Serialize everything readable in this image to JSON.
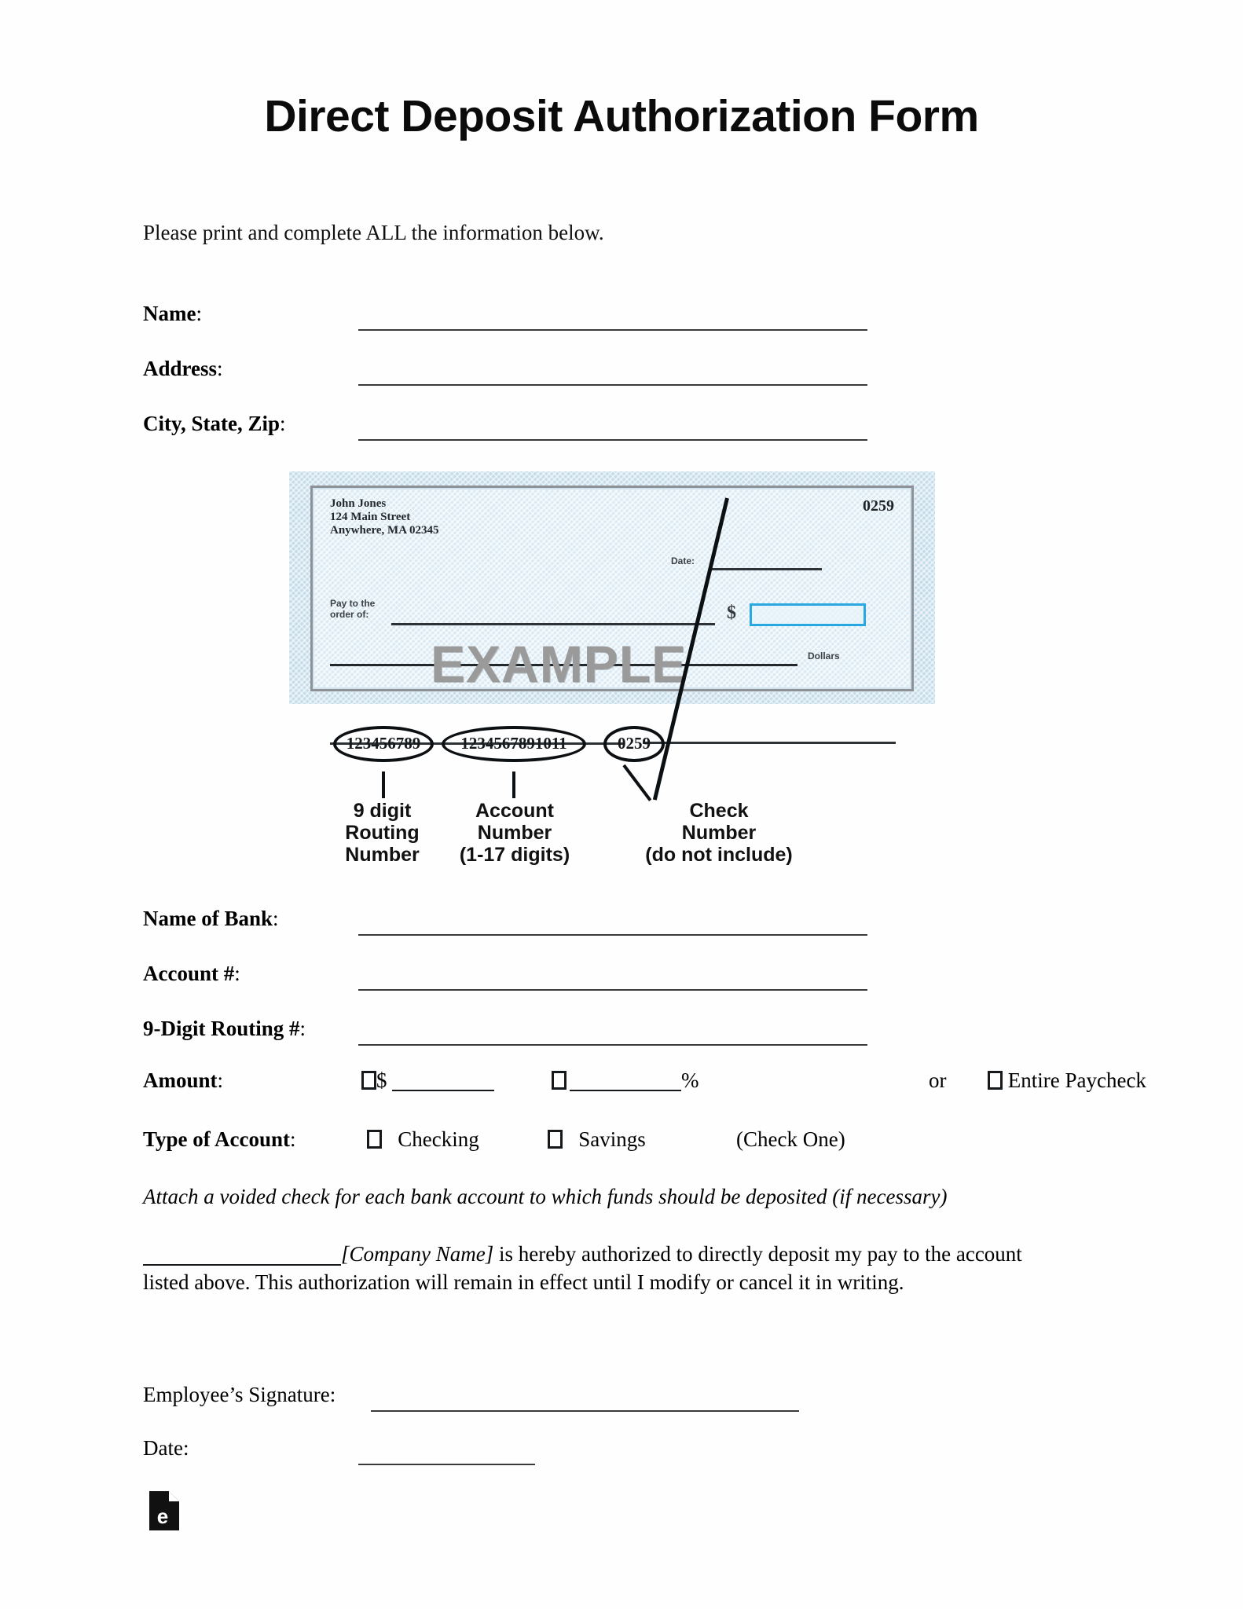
{
  "document": {
    "title": "Direct Deposit Authorization Form",
    "intro": "Please print and complete ALL the information below."
  },
  "personal_fields": [
    {
      "label": "Name",
      "colon": ":"
    },
    {
      "label": "Address",
      "colon": ":"
    },
    {
      "label": "City, State, Zip",
      "colon": ":"
    }
  ],
  "check_illustration": {
    "payer_block": "John Jones\n124 Main Street\nAnywhere, MA 02345",
    "check_number_top": "0259",
    "date_label": "Date:",
    "pay_to_label": "Pay to the\norder of:",
    "dollar_sign": "$",
    "dollars_label": "Dollars",
    "watermark": "EXAMPLE",
    "micr": {
      "routing": "123456789",
      "account": "1234567891011",
      "check_number": "0259"
    },
    "captions": {
      "routing": "9 digit\nRouting\nNumber",
      "account": "Account\nNumber\n(1-17 digits)",
      "check_number": "Check\nNumber\n(do not include)"
    },
    "colors": {
      "check_outer_band": "#c4dcea",
      "check_face": "#d9eaf4",
      "check_border": "#8e9296",
      "amount_box_border": "#27a8e0",
      "watermark_text": "#9a9a9a"
    }
  },
  "bank_fields": [
    {
      "label": "Name of Bank",
      "colon": ":"
    },
    {
      "label": "Account #",
      "colon": ":"
    },
    {
      "label": "9-Digit Routing #",
      "colon": ":"
    }
  ],
  "amount_row": {
    "label": "Amount",
    "colon": ":",
    "option_dollar_prefix": "$",
    "option_percent_suffix": "%",
    "or_text": "or",
    "option_entire_paycheck": "Entire Paycheck"
  },
  "account_type_row": {
    "label": "Type of Account",
    "colon": ":",
    "option_checking": "Checking",
    "option_savings": "Savings",
    "note": "(Check One)"
  },
  "attach_note": "Attach a voided check for each bank account to which funds should be deposited (if necessary)",
  "authorization": {
    "company_placeholder": "[Company Name]",
    "text_after": " is hereby authorized to directly deposit my pay to the account listed above. This authorization will remain in effect until I modify or cancel it in writing."
  },
  "signature_row": {
    "label": "Employee’s Signature:"
  },
  "date_row": {
    "label": "Date:"
  },
  "logo": {
    "glyph": "e",
    "name": "eforms-document-logo"
  }
}
